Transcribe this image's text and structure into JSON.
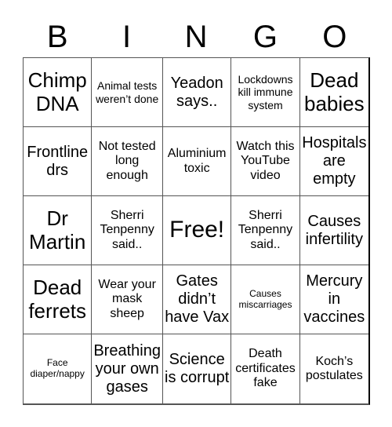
{
  "header": [
    "B",
    "I",
    "N",
    "G",
    "O"
  ],
  "cells": [
    "Chimp DNA",
    "Animal tests weren’t done",
    "Yeadon says..",
    "Lockdowns kill immune system",
    "Dead babies",
    "Frontline drs",
    "Not tested long enough",
    "Aluminium toxic",
    "Watch this YouTube video",
    "Hospitals are empty",
    "Dr Martin",
    "Sherri Tenpenny said..",
    "Free!",
    "Sherri Tenpenny said..",
    "Causes infertility",
    "Dead ferrets",
    "Wear your mask sheep",
    "Gates didn’t have Vax",
    "Causes miscarriages",
    "Mercury in vaccines",
    "Face diaper/nappy",
    "Breathing your own gases",
    "Science is corrupt",
    "Death certificates fake",
    "Koch’s postulates"
  ]
}
